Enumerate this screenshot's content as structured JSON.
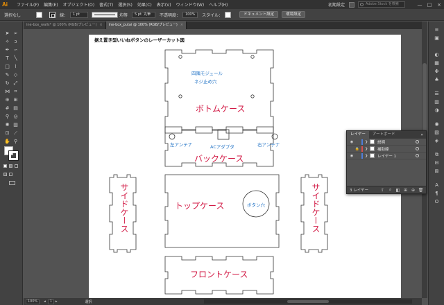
{
  "menubar": {
    "app_logo": "Ai",
    "items": [
      "ファイル(F)",
      "編集(E)",
      "オブジェクト(O)",
      "書式(T)",
      "選択(S)",
      "効果(C)",
      "表示(V)",
      "ウィンドウ(W)",
      "ヘルプ(H)"
    ],
    "workspace": "初期設定",
    "stock_search_placeholder": "Adobe Stock を検索",
    "window_buttons": [
      "—",
      "□",
      "×"
    ]
  },
  "controlbar": {
    "selection_status": "選択なし",
    "stroke_label": "線：",
    "stroke_weight": "1 pt",
    "stroke_profile": "均等",
    "brush_def": "5 pt. 丸筆",
    "opacity_label": "不透明度：",
    "opacity_value": "100%",
    "style_label": "スタイル：",
    "document_setup_button": "ドキュメント設定",
    "preferences_button": "環境設定"
  },
  "tabs": [
    {
      "label": "ine-box_walls* @ 100% (RGB/プレビュー)",
      "active": false
    },
    {
      "label": "ine-box_putai @ 100% (RGB/プレビュー)",
      "active": true
    }
  ],
  "artboard": {
    "title": "据え置き型いいねボタンのレーザーカット図",
    "parts": {
      "bottom": "ボトムケース",
      "back": "バックケース",
      "top": "トップケース",
      "side_left": "サイドケース",
      "side_right": "サイドケース",
      "front": "フロントケース"
    },
    "notes": {
      "module_line1": "四隅モジュール",
      "module_line2": "ネジ止め穴",
      "left_antenna": "左アンテナ",
      "right_antenna": "右アンテナ",
      "ac_adapter": "ACアダプタ",
      "button_hole": "ボタン穴"
    }
  },
  "layers_panel": {
    "tabs": [
      "レイヤー",
      "アートボード"
    ],
    "menu_icon": "»",
    "layers": [
      {
        "name": "説明",
        "color": "#4f7fd9"
      },
      {
        "name": "補助線",
        "color": "#d94f4f"
      },
      {
        "name": "レイヤー 1",
        "color": "#4f7fd9"
      }
    ],
    "footer_count": "3 レイヤー"
  },
  "statusbar": {
    "zoom": "100%",
    "artboard_number": "1",
    "tool_name": "選択"
  },
  "colors": {
    "part_label": "#d21a45",
    "note_label": "#2a78c8",
    "ui_dark": "#323232",
    "ui_panel": "#424242",
    "ui_canvas": "#535353"
  }
}
